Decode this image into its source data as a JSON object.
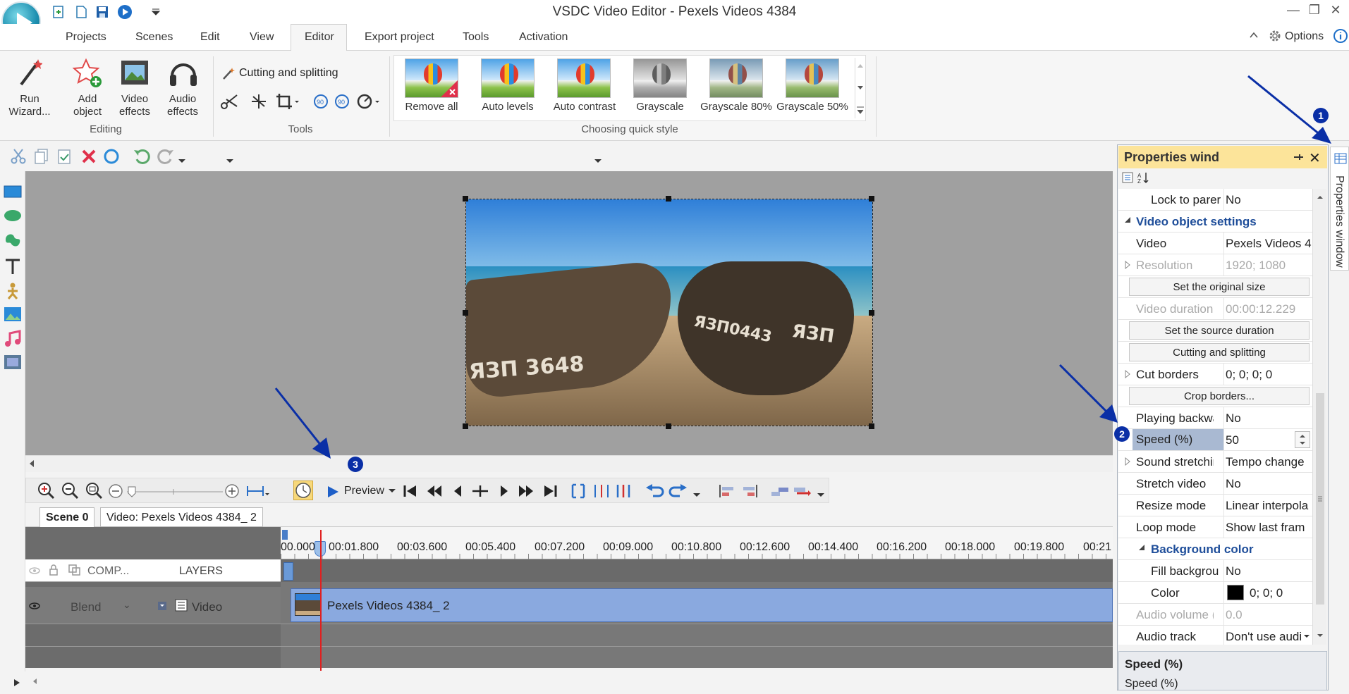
{
  "window": {
    "title": "VSDC Video Editor - Pexels Videos 4384"
  },
  "menu": {
    "tabs": [
      "Projects",
      "Scenes",
      "Edit",
      "View",
      "Editor",
      "Export project",
      "Tools",
      "Activation"
    ],
    "active": "Editor",
    "options_label": "Options"
  },
  "ribbon": {
    "editing": {
      "run_wizard": "Run Wizard...",
      "add_object": "Add object",
      "video_effects": "Video effects",
      "audio_effects": "Audio effects",
      "group_label": "Editing"
    },
    "tools": {
      "cutting_splitting": "Cutting and splitting",
      "group_label": "Tools"
    },
    "quick_style": {
      "items": [
        "Remove all",
        "Auto levels",
        "Auto contrast",
        "Grayscale",
        "Grayscale 80%",
        "Grayscale 50%"
      ],
      "group_label": "Choosing quick style"
    }
  },
  "timeline": {
    "preview_label": "Preview",
    "scene_tab": "Scene 0",
    "video_tab": "Video: Pexels Videos 4384_ 2",
    "ruler_ticks": [
      "00.000",
      "00:01.800",
      "00:03.600",
      "00:05.400",
      "00:07.200",
      "00:09.000",
      "00:10.800",
      "00:12.600",
      "00:14.400",
      "00:16.200",
      "00:18.000",
      "00:19.800",
      "00:21"
    ],
    "header_comp": "COMP...",
    "header_layers": "LAYERS",
    "row_blend": "Blend",
    "row_type": "Video",
    "clip_label": "Pexels Videos 4384_ 2"
  },
  "canvas": {
    "boat_left_text": "ЯЗП 3648",
    "boat_right_text_a": "ЯЗП0443",
    "boat_right_text_b": "ЯЗП"
  },
  "properties": {
    "title": "Properties wind",
    "side_tab": "Properties window",
    "rows": [
      {
        "key": "Lock to parer",
        "value": "No",
        "indent": true
      },
      {
        "section": "Video object settings"
      },
      {
        "key": "Video",
        "value": "Pexels Videos 4"
      },
      {
        "key": "Resolution",
        "value": "1920; 1080",
        "disabled": true
      },
      {
        "button": "Set the original size"
      },
      {
        "key": "Video duration",
        "value": "00:00:12.229",
        "disabled": true
      },
      {
        "button": "Set the source duration"
      },
      {
        "button": "Cutting and splitting"
      },
      {
        "key": "Cut borders",
        "value": "0; 0; 0; 0"
      },
      {
        "button": "Crop borders..."
      },
      {
        "key": "Playing backwa",
        "value": "No"
      },
      {
        "key": "Speed (%)",
        "value": "50",
        "selected": true
      },
      {
        "key": "Sound stretchin",
        "value": "Tempo change"
      },
      {
        "key": "Stretch video",
        "value": "No"
      },
      {
        "key": "Resize mode",
        "value": "Linear interpola"
      },
      {
        "key": "Loop mode",
        "value": "Show last fram"
      },
      {
        "section": "Background color",
        "sub": true
      },
      {
        "key": "Fill backgrou",
        "value": "No",
        "indent": true
      },
      {
        "key": "Color",
        "value": "0; 0; 0",
        "indent": true,
        "swatch": "#000000"
      },
      {
        "key": "Audio volume (",
        "value": "0.0",
        "disabled": true
      },
      {
        "key": "Audio track",
        "value": "Don't use audi"
      }
    ],
    "desc_title": "Speed (%)",
    "desc_text": "Speed (%)"
  },
  "annotations": {
    "badge1": "1",
    "badge2": "2",
    "badge3": "3"
  },
  "colors": {
    "accent": "#0a2fa6",
    "props_title_bg": "#fce49a",
    "section_text": "#1f4e9a",
    "clip_bg": "#8aa9df"
  }
}
